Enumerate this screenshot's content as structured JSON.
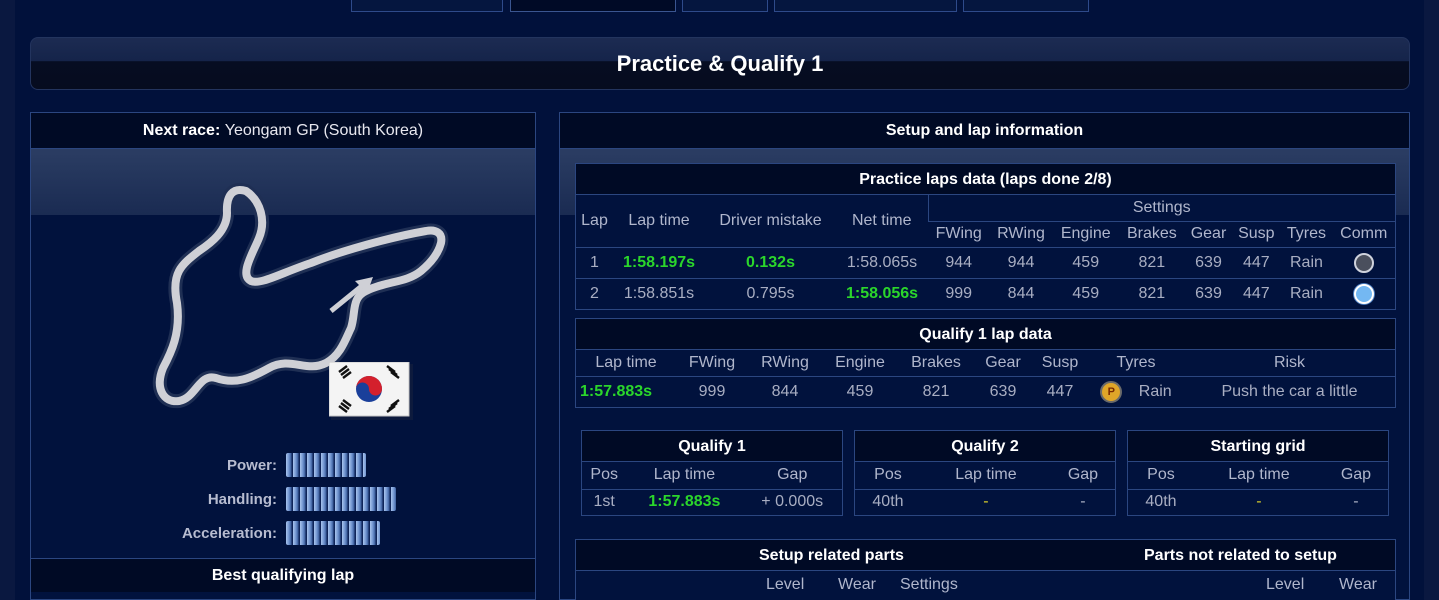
{
  "page": {
    "title": "Practice & Qualify 1"
  },
  "left": {
    "next_race_label": "Next race:",
    "race_name": "Yeongam GP (South Korea)",
    "stats": [
      {
        "label": "Power:",
        "level": 0.54
      },
      {
        "label": "Handling:",
        "level": 0.76
      },
      {
        "label": "Acceleration:",
        "level": 0.65
      }
    ],
    "best_lap_title": "Best qualifying lap"
  },
  "setup": {
    "title": "Setup and lap information",
    "practice": {
      "title": "Practice laps data (laps done 2/8)",
      "cols": [
        "Lap",
        "Lap time",
        "Driver mistake",
        "Net time"
      ],
      "settings_label": "Settings",
      "setting_cols": [
        "FWing",
        "RWing",
        "Engine",
        "Brakes",
        "Gear",
        "Susp",
        "Tyres",
        "Comm"
      ],
      "rows": [
        {
          "lap": "1",
          "lap_time": "1:58.197s",
          "mistake": "0.132s",
          "net": "1:58.065s",
          "fwing": "944",
          "rwing": "944",
          "engine": "459",
          "brakes": "821",
          "gear": "639",
          "susp": "447",
          "tyres": "Rain"
        },
        {
          "lap": "2",
          "lap_time": "1:58.851s",
          "mistake": "0.795s",
          "net": "1:58.056s",
          "fwing": "999",
          "rwing": "844",
          "engine": "459",
          "brakes": "821",
          "gear": "639",
          "susp": "447",
          "tyres": "Rain"
        }
      ]
    },
    "qualify1": {
      "title": "Qualify 1 lap data",
      "cols": [
        "Lap time",
        "FWing",
        "RWing",
        "Engine",
        "Brakes",
        "Gear",
        "Susp",
        "Tyres",
        "Risk"
      ],
      "row": {
        "lap_time": "1:57.883s",
        "fwing": "999",
        "rwing": "844",
        "engine": "459",
        "brakes": "821",
        "gear": "639",
        "susp": "447",
        "tyre_badge": "P",
        "tyres": "Rain",
        "risk": "Push the car a little"
      }
    },
    "results": [
      {
        "title": "Qualify 1",
        "pos": "1st",
        "lap_time": "1:57.883s",
        "gap": "+ 0.000s"
      },
      {
        "title": "Qualify 2",
        "pos": "40th",
        "lap_time": "-",
        "gap": "-"
      },
      {
        "title": "Starting grid",
        "pos": "40th",
        "lap_time": "-",
        "gap": "-"
      }
    ],
    "results_cols": [
      "Pos",
      "Lap time",
      "Gap"
    ],
    "parts": {
      "setup_title": "Setup related parts",
      "nonsetup_title": "Parts not related to setup",
      "setup_cols": [
        "Level",
        "Wear",
        "Settings"
      ],
      "nonsetup_cols": [
        "Level",
        "Wear"
      ]
    }
  },
  "colors": {
    "accent_green": "#2bd62b",
    "dash_yellow": "#d6cc2b",
    "panel_bg": "#01123d"
  },
  "icons": {
    "track": "yeongam-circuit-map",
    "flag": "south-korea-flag",
    "comm_off": "radio-off-icon",
    "comm_on": "radio-on-icon",
    "tyre": "tyre-badge-icon"
  }
}
